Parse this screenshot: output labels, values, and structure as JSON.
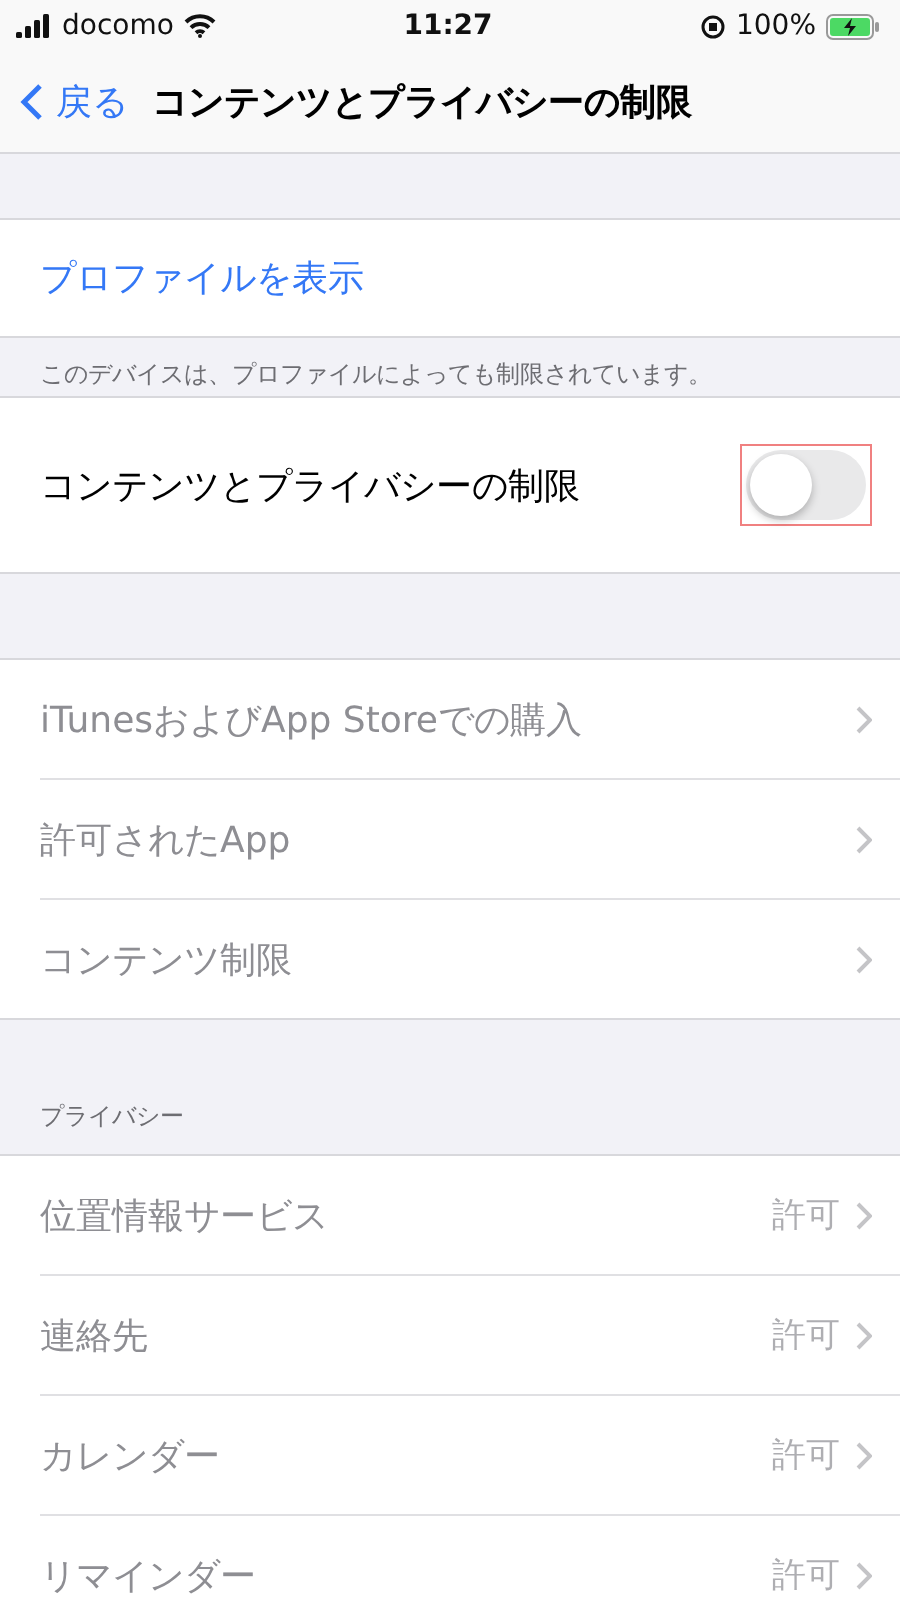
{
  "status_bar": {
    "carrier": "docomo",
    "time": "11:27",
    "battery": "100%"
  },
  "nav": {
    "back": "戻る",
    "title": "コンテンツとプライバシーの制限"
  },
  "profile": {
    "link": "プロファイルを表示",
    "footer": "このデバイスは、プロファイルによっても制限されています。"
  },
  "restriction": {
    "label": "コンテンツとプライバシーの制限",
    "on": false,
    "highlighted": true
  },
  "store_items": [
    {
      "label": "iTunesおよびApp Storeでの購入",
      "disabled": true
    },
    {
      "label": "許可されたApp",
      "disabled": true
    },
    {
      "label": "コンテンツ制限",
      "disabled": true
    }
  ],
  "privacy": {
    "header": "プライバシー",
    "items": [
      {
        "label": "位置情報サービス",
        "value": "許可",
        "disabled": true
      },
      {
        "label": "連絡先",
        "value": "許可",
        "disabled": true
      },
      {
        "label": "カレンダー",
        "value": "許可",
        "disabled": true
      },
      {
        "label": "リマインダー",
        "value": "許可",
        "disabled": true
      }
    ]
  }
}
